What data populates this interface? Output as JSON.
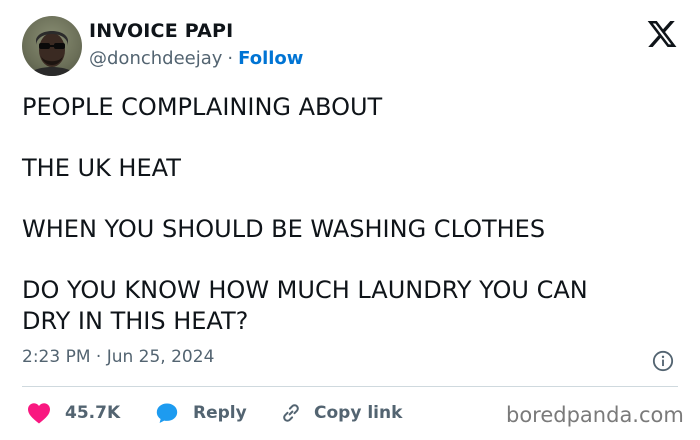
{
  "author": {
    "display_name": "INVOICE PAPI",
    "handle": "@donchdeejay",
    "separator": "·",
    "follow_label": "Follow"
  },
  "tweet": {
    "lines": [
      "PEOPLE COMPLAINING ABOUT",
      "THE UK HEAT",
      "WHEN YOU SHOULD BE WASHING CLOTHES",
      "DO YOU KNOW HOW MUCH LAUNDRY YOU CAN",
      "DRY IN THIS HEAT?"
    ],
    "timestamp": "2:23 PM · Jun 25, 2024"
  },
  "actions": {
    "likes_count": "45.7K",
    "reply_label": "Reply",
    "copy_link_label": "Copy link"
  },
  "watermark": "boredpanda.com",
  "icons": {
    "brand": "x-logo-icon",
    "info": "info-icon",
    "like": "heart-icon",
    "reply": "speech-bubble-icon",
    "copy": "link-icon"
  },
  "colors": {
    "text": "#0f1419",
    "secondary": "#536471",
    "follow_blue": "#0074d4",
    "heart": "#f91880",
    "reply_blue": "#1d9bf0",
    "divider": "#cfd9de"
  }
}
